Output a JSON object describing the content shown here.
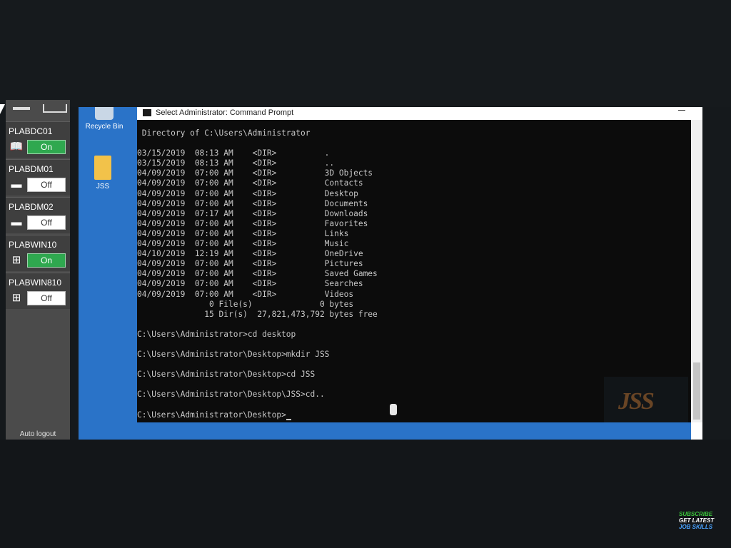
{
  "vm_panel": {
    "items": [
      {
        "name": "PLABDC01",
        "icon": "book-icon",
        "state": "On"
      },
      {
        "name": "PLABDM01",
        "icon": "drive-icon",
        "state": "Off"
      },
      {
        "name": "PLABDM02",
        "icon": "drive-icon",
        "state": "Off"
      },
      {
        "name": "PLABWIN10",
        "icon": "windows-icon",
        "state": "On"
      },
      {
        "name": "PLABWIN810",
        "icon": "windows-icon",
        "state": "Off"
      }
    ],
    "auto_logout": "Auto logout",
    "colors": {
      "on": "#2fa84f",
      "off": "#ffffff"
    }
  },
  "desktop": {
    "icons": [
      {
        "label": "Recycle Bin",
        "icon": "recycle-bin-icon"
      },
      {
        "label": "JSS",
        "icon": "folder-icon"
      }
    ],
    "background": "#2a73c8"
  },
  "cmd": {
    "title": "Select Administrator: Command Prompt",
    "lines": [
      " Directory of C:\\Users\\Administrator",
      "",
      "03/15/2019  08:13 AM    <DIR>          .",
      "03/15/2019  08:13 AM    <DIR>          ..",
      "04/09/2019  07:00 AM    <DIR>          3D Objects",
      "04/09/2019  07:00 AM    <DIR>          Contacts",
      "04/09/2019  07:00 AM    <DIR>          Desktop",
      "04/09/2019  07:00 AM    <DIR>          Documents",
      "04/09/2019  07:17 AM    <DIR>          Downloads",
      "04/09/2019  07:00 AM    <DIR>          Favorites",
      "04/09/2019  07:00 AM    <DIR>          Links",
      "04/09/2019  07:00 AM    <DIR>          Music",
      "04/10/2019  12:19 AM    <DIR>          OneDrive",
      "04/09/2019  07:00 AM    <DIR>          Pictures",
      "04/09/2019  07:00 AM    <DIR>          Saved Games",
      "04/09/2019  07:00 AM    <DIR>          Searches",
      "04/09/2019  07:00 AM    <DIR>          Videos",
      "               0 File(s)              0 bytes",
      "              15 Dir(s)  27,821,473,792 bytes free",
      "",
      "C:\\Users\\Administrator>cd desktop",
      "",
      "C:\\Users\\Administrator\\Desktop>mkdir JSS",
      "",
      "C:\\Users\\Administrator\\Desktop>cd JSS",
      "",
      "C:\\Users\\Administrator\\Desktop\\JSS>cd..",
      ""
    ],
    "prompt": "C:\\Users\\Administrator\\Desktop>"
  },
  "watermark": {
    "text": "JSS"
  },
  "subscribe": {
    "line1": "SUBSCRIBE",
    "line2": "GET LATEST",
    "line3": "JOB SKILLS"
  }
}
